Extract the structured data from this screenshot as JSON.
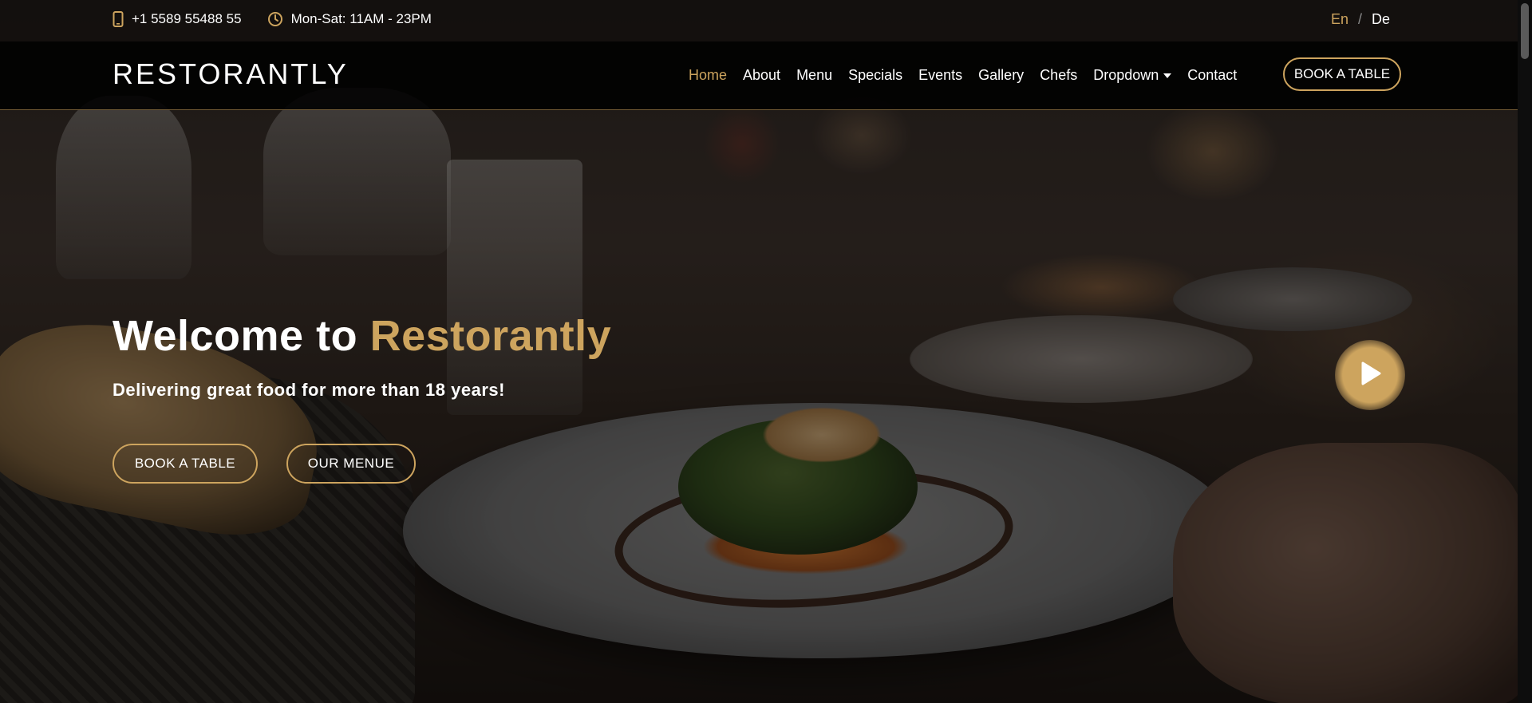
{
  "topbar": {
    "phone": "+1 5589 55488 55",
    "hours": "Mon-Sat: 11AM - 23PM",
    "phone_icon": "phone-icon",
    "clock_icon": "clock-icon",
    "lang_en": "En",
    "lang_sep": "/",
    "lang_de": "De"
  },
  "header": {
    "logo": "RESTORANTLY",
    "nav": {
      "home": "Home",
      "about": "About",
      "menu": "Menu",
      "specials": "Specials",
      "events": "Events",
      "gallery": "Gallery",
      "chefs": "Chefs",
      "dropdown": "Dropdown",
      "contact": "Contact"
    },
    "book_button": "BOOK A TABLE"
  },
  "hero": {
    "title_prefix": "Welcome to",
    "title_brand": "Restorantly",
    "subtitle": "Delivering great food for more than 18 years!",
    "book_button": "BOOK A TABLE",
    "menu_button": "OUR MENUE",
    "play_icon": "play-icon"
  },
  "colors": {
    "accent": "#cda45e",
    "header_bg": "#000000",
    "text": "#ffffff"
  }
}
